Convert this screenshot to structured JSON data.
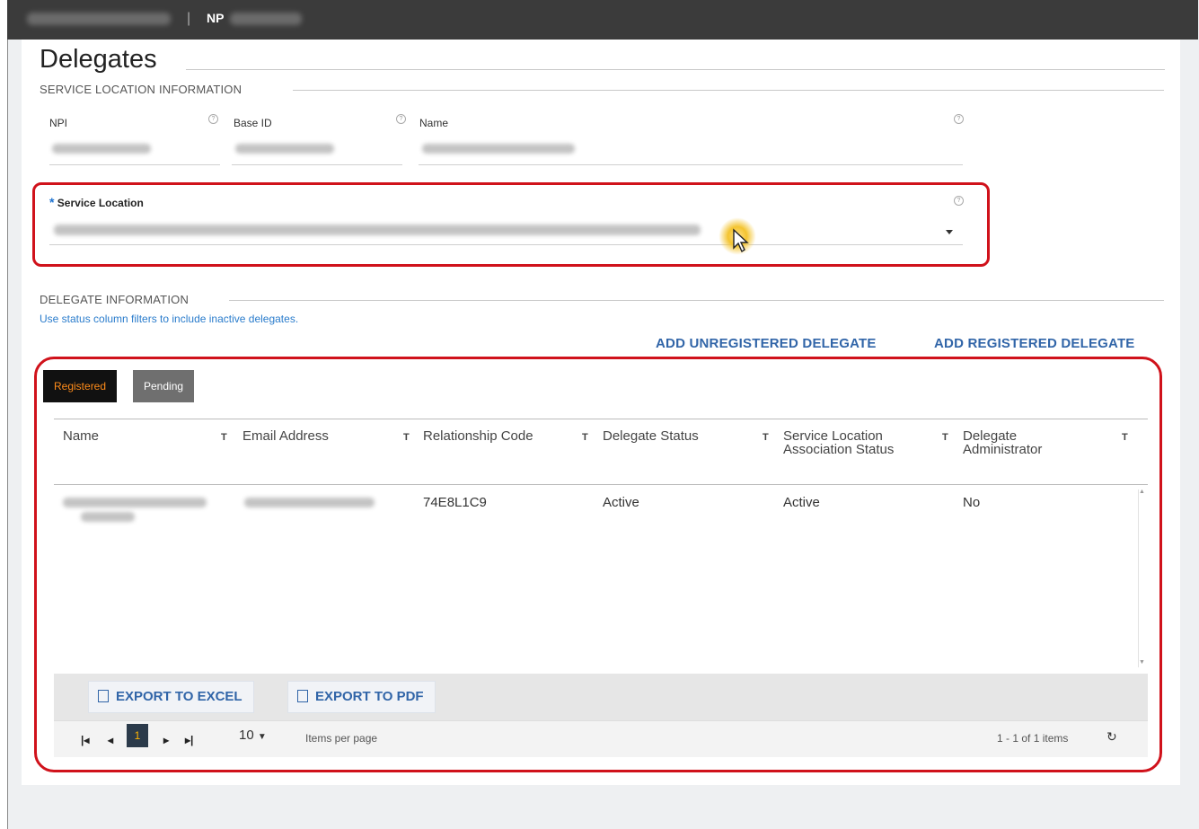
{
  "topbar": {
    "np_label": "NP"
  },
  "page_title": "Delegates",
  "service_location_info": {
    "section_label": "SERVICE LOCATION INFORMATION",
    "npi_label": "NPI",
    "base_id_label": "Base ID",
    "name_label": "Name"
  },
  "service_location": {
    "label": "Service Location"
  },
  "delegate_info": {
    "section_label": "DELEGATE INFORMATION",
    "hint": "Use status column filters to include inactive delegates.",
    "add_unregistered": "ADD UNREGISTERED DELEGATE",
    "add_registered": "ADD REGISTERED DELEGATE"
  },
  "tabs": {
    "registered": "Registered",
    "pending": "Pending"
  },
  "table": {
    "headers": [
      "Name",
      "Email Address",
      "Relationship Code",
      "Delegate Status",
      "Service Location Association Status",
      "Delegate Administrator"
    ],
    "rows": [
      {
        "relationship_code": "74E8L1C9",
        "delegate_status": "Active",
        "association_status": "Active",
        "administrator": "No"
      }
    ]
  },
  "export": {
    "excel": "EXPORT TO EXCEL",
    "pdf": "EXPORT TO PDF"
  },
  "pager": {
    "current_page": "1",
    "page_size": "10",
    "per_page_label": "Items per page",
    "count_text": "1 - 1 of 1 items"
  },
  "colors": {
    "accent_blue": "#3165a8",
    "highlight_red": "#d0121b",
    "active_tab_text": "#ff8c1a"
  }
}
